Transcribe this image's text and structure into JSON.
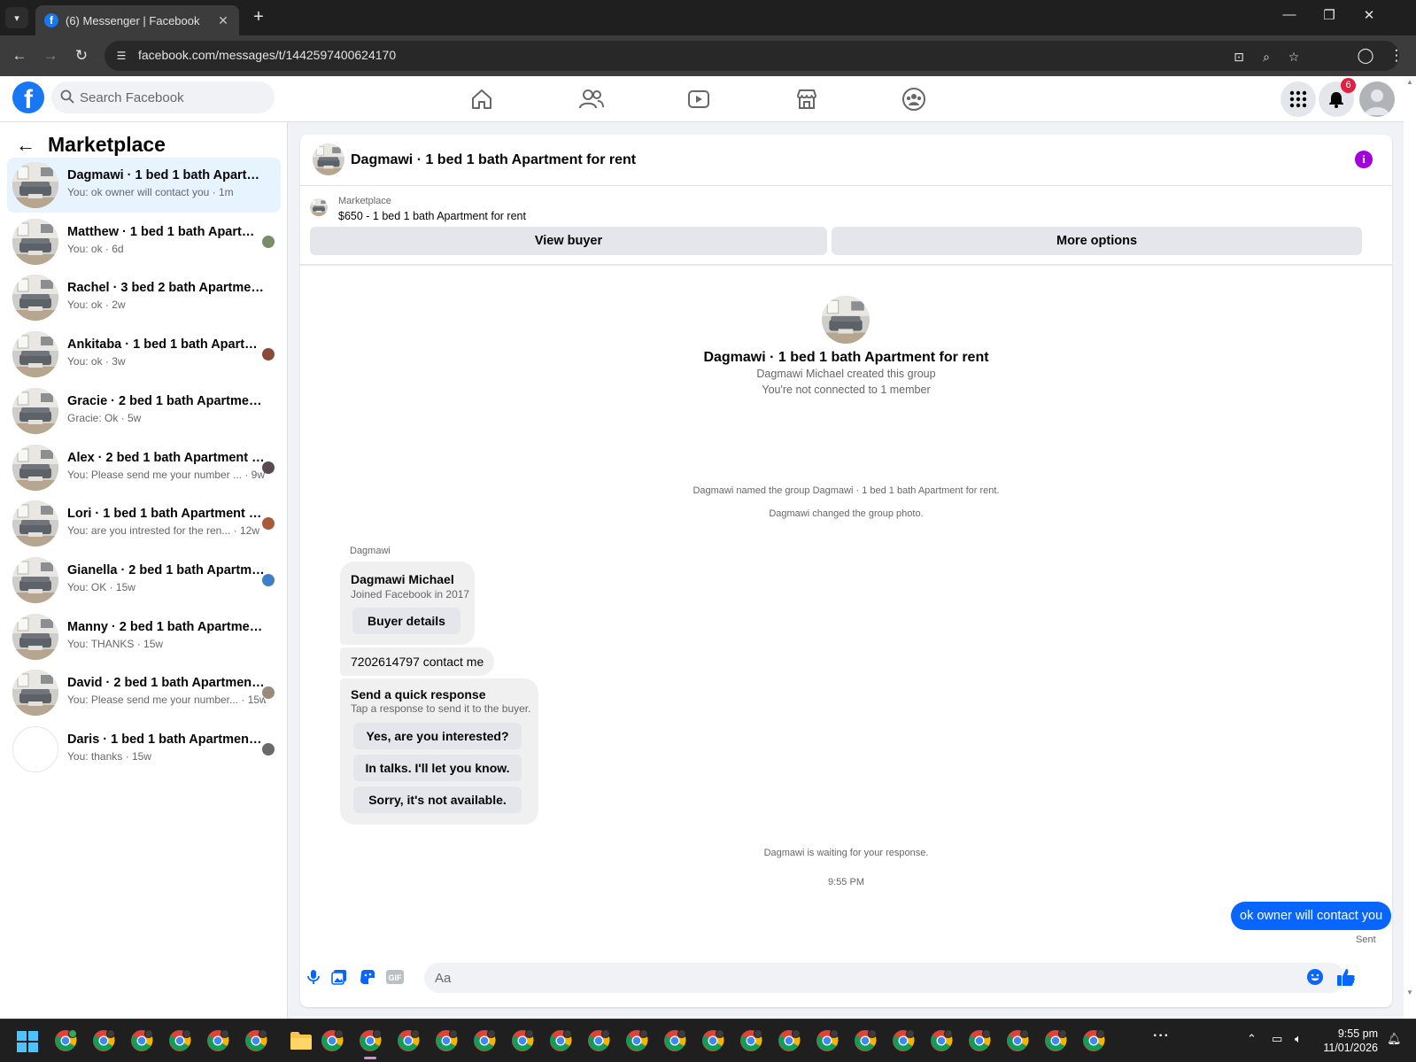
{
  "browser": {
    "tab_title": "(6) Messenger | Facebook",
    "url": "facebook.com/messages/t/1442597400624170"
  },
  "header": {
    "search_placeholder": "Search Facebook",
    "notification_count": "6"
  },
  "sidebar": {
    "title": "Marketplace",
    "conversations": [
      {
        "name": "Dagmawi · 1 bed 1 bath Apartment...",
        "preview": "You: ok owner will contact you · 1m"
      },
      {
        "name": "Matthew · 1 bed 1 bath Apartme...",
        "preview": "You: ok · 6d"
      },
      {
        "name": "Rachel · 3 bed 2 bath Apartment f...",
        "preview": "You: ok · 2w"
      },
      {
        "name": "Ankitaba · 1 bed 1 bath Apartme...",
        "preview": "You: ok · 3w"
      },
      {
        "name": "Gracie · 2 bed 1 bath Apartment fo...",
        "preview": "Gracie: Ok · 5w"
      },
      {
        "name": "Alex · 2 bed 1 bath Apartment f...",
        "preview": "You: Please send me your number ... · 9w"
      },
      {
        "name": "Lori · 1 bed 1 bath Apartment fo...",
        "preview": "You: are you intrested for the ren... · 12w"
      },
      {
        "name": "Gianella · 2 bed 1 bath Apartme...",
        "preview": "You: OK · 15w"
      },
      {
        "name": "Manny · 2 bed 1 bath Apartment f...",
        "preview": "You: THANKS · 15w"
      },
      {
        "name": "David · 2 bed 1 bath Apartment ...",
        "preview": "You: Please send me your number... · 15w"
      },
      {
        "name": "Daris · 1 bed 1 bath Apartment f...",
        "preview": "You: thanks · 15w"
      }
    ]
  },
  "chat": {
    "title": "Dagmawi · 1 bed 1 bath Apartment for rent",
    "listing_category": "Marketplace",
    "listing_item": "$650 - 1 bed 1 bath Apartment for rent",
    "view_buyer_label": "View buyer",
    "more_options_label": "More options",
    "intro_title": "Dagmawi · 1 bed 1 bath Apartment for rent",
    "intro_created": "Dagmawi Michael created this group",
    "intro_connected": "You're not connected to 1 member",
    "sys_named": "Dagmawi named the group Dagmawi · 1 bed 1 bath Apartment for rent.",
    "sys_photo": "Dagmawi changed the group photo.",
    "sender_label": "Dagmawi",
    "buyer_name": "Dagmawi Michael",
    "buyer_joined": "Joined Facebook in 2017",
    "buyer_details_label": "Buyer details",
    "incoming_message": "7202614797 contact me",
    "quick_title": "Send a quick response",
    "quick_sub": "Tap a response to send it to the buyer.",
    "quick_responses": [
      "Yes, are you interested?",
      "In talks. I'll let you know.",
      "Sorry, it's not available."
    ],
    "waiting_text": "Dagmawi is waiting for your response.",
    "timestamp": "9:55 PM",
    "outgoing_message": "ok owner will contact you",
    "sent_label": "Sent",
    "composer_placeholder": "Aa"
  },
  "taskbar": {
    "time": "9:55 pm",
    "date": "11/01/2026"
  },
  "colors": {
    "brand": "#1877f2",
    "messenger_blue": "#0866ff",
    "info_purple": "#a300e0",
    "active_conversation": "#e7f3ff"
  }
}
